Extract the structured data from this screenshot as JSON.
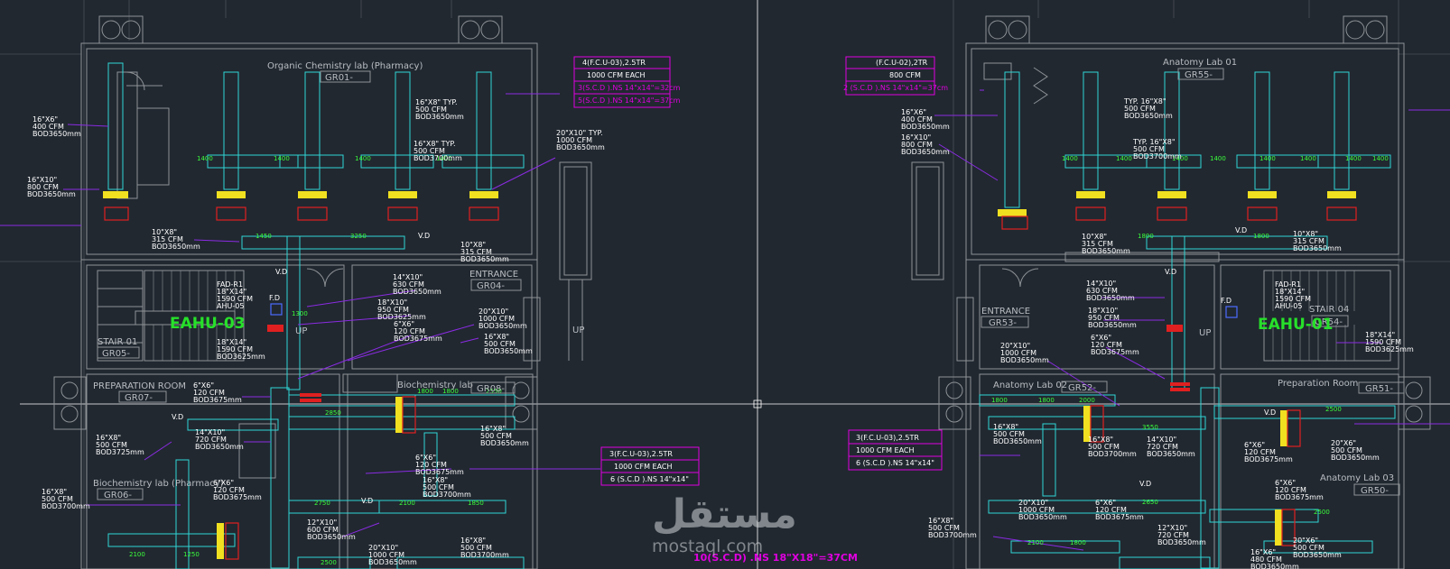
{
  "colors": {
    "background": "#212830",
    "wall": "#8d9296",
    "duct": "#2fd6d6",
    "leader": "#8a2be2",
    "magenta": "#e000e0",
    "green": "#27e12a",
    "yellow": "#f0e020",
    "red": "#e02020"
  },
  "rooms": {
    "organic": "Organic  Chemistry lab  (Pharmacy)",
    "gr01": "GR01-",
    "anatomy01": "Anatomy Lab 01",
    "gr55": "GR55-",
    "entrance_l": "ENTRANCE",
    "gr04": "GR04-",
    "entrance_r": "ENTRANCE",
    "gr53": "GR53-",
    "stair01": "STAIR 01",
    "gr05": "GR05-",
    "stair04": "STAIR 04",
    "gr54": "GR54-",
    "prep_l": "PREPARATION ROOM",
    "gr07": "GR07-",
    "biochem": "Biochemistry lab",
    "gr08": "GR08-",
    "anatomy02": "Anatomy Lab 02",
    "gr52": "GR52-",
    "prep_r": "Preparation Room",
    "gr51": "GR51-",
    "biochem_ph": "Biochemistry lab (Pharmacy)",
    "gr06": "GR06-",
    "anatomy03": "Anatomy Lab 03",
    "gr50": "GR50-",
    "up_l": "UP",
    "up_c": "UP",
    "up_r": "UP"
  },
  "equipment": {
    "eahu03": "EAHU-03",
    "eahu01": "EAHU-01",
    "fad_l": [
      "FAD-R1",
      "18\"X14\"",
      "1590 CFM",
      "AHU-05"
    ],
    "fad_r": [
      "FAD-R1",
      "18\"X14\"",
      "1590 CFM",
      "AHU-05"
    ],
    "fd_l": "F.D",
    "fd_r": "F.D"
  },
  "boxes": {
    "box1": [
      "4(F.C.U-03),2.5TR",
      "1000 CFM EACH",
      "3(S.C.D ).NS 14\"x14\"=32cm",
      "5(S.C.D ).NS 14\"x14\"=37cm"
    ],
    "box2": [
      "(F.C.U-02),2TR",
      "800 CFM",
      "2 (S.C.D ).NS 14\"x14\"=37cm"
    ],
    "box3": [
      "3(F.C.U-03),2.5TR",
      "1000 CFM EACH",
      "6  (S.C.D ).NS 14\"x14\""
    ],
    "box4": [
      "3(F.C.U-03),2.5TR",
      "1000 CFM EACH",
      "6  (S.C.D ).NS 14\"x14\""
    ]
  },
  "bottom_note": "10(S.C.D) .NS 18\"X18\"=37CM",
  "labels": [
    [
      "16\"X6\"",
      "400 CFM",
      "BOD3650mm"
    ],
    [
      "16\"X10\"",
      "800 CFM",
      "BOD3650mm"
    ],
    [
      "16\"X8\"  TYP.",
      "500 CFM",
      "BOD3650mm"
    ],
    [
      "16\"X8\" TYP.",
      "500 CFM",
      "BOD3700mm"
    ],
    [
      "20\"X10\" TYP.",
      "1000 CFM",
      "BOD3650mm"
    ],
    [
      "10\"X8\"",
      "315 CFM",
      "BOD3650mm"
    ],
    [
      "10\"X8\"",
      "315 CFM",
      "BOD3650mm"
    ],
    [
      "14\"X10\"",
      "630 CFM",
      "BOD3650mm"
    ],
    [
      "18\"X10\"",
      "950 CFM",
      "BOD3625mm"
    ],
    [
      "20\"X10\"",
      "1000 CFM",
      "BOD3650mm"
    ],
    [
      "6\"X6\"",
      "120 CFM",
      "BOD3675mm"
    ],
    [
      "16\"X8\"",
      "500 CFM",
      "BOD3650mm"
    ],
    [
      "18\"X14\"",
      "1590 CFM",
      "BOD3625mm"
    ],
    [
      "6\"X6\"",
      "120 CFM",
      "BOD3675mm"
    ],
    [
      "14\"X10\"",
      "720 CFM",
      "BOD3650mm"
    ],
    [
      "16\"X8\"",
      "500 CFM",
      "BOD3725mm"
    ],
    [
      "16\"X8\"",
      "500 CFM",
      "BOD3700mm"
    ],
    [
      "6\"X6\"",
      "120 CFM",
      "BOD3675mm"
    ],
    [
      "6\"X6\"",
      "120 CFM",
      "BOD3675mm"
    ],
    [
      "16\"X8\"",
      "500 CFM",
      "BOD3650mm"
    ],
    [
      "16\"X8\"",
      "500 CFM",
      "BOD3700mm"
    ],
    [
      "12\"X10\"",
      "600 CFM",
      "BOD3650mm"
    ],
    [
      "20\"X10\"",
      "1000 CFM",
      "BOD3650mm"
    ],
    [
      "16\"X8\"",
      "500 CFM",
      "BOD3700mm"
    ],
    [
      "16\"X6\"",
      "400 CFM",
      "BOD3650mm"
    ],
    [
      "16\"X10\"",
      "800 CFM",
      "BOD3650mm"
    ],
    [
      "TYP.  16\"X8\"",
      "500 CFM",
      "BOD3650mm"
    ],
    [
      "TYP.  16\"X8\"",
      "500 CFM",
      "BOD3700mm"
    ],
    [
      "10\"X8\"",
      "315 CFM",
      "BOD3650mm"
    ],
    [
      "10\"X8\"",
      "315 CFM",
      "BOD3650mm"
    ],
    [
      "14\"X10\"",
      "630 CFM",
      "BOD3650mm"
    ],
    [
      "18\"X10\"",
      "950 CFM",
      "BOD3650mm"
    ],
    [
      "6\"X6\"",
      "120 CFM",
      "BOD3675mm"
    ],
    [
      "18\"X14\"",
      "1590 CFM",
      "BOD3625mm"
    ],
    [
      "20\"X10\"",
      "1000 CFM",
      "BOD3650mm"
    ],
    [
      "16\"X8\"",
      "500 CFM",
      "BOD3650mm"
    ],
    [
      "16\"X8\"",
      "500 CFM",
      "BOD3700mm"
    ],
    [
      "14\"X10\"",
      "720 CFM",
      "BOD3650mm"
    ],
    [
      "6\"X6\"",
      "120 CFM",
      "BOD3675mm"
    ],
    [
      "20\"X6\"",
      "500 CFM",
      "BOD3650mm"
    ],
    [
      "6\"X6\"",
      "120 CFM",
      "BOD3675mm"
    ],
    [
      "20\"X10\"",
      "1000 CFM",
      "BOD3650mm"
    ],
    [
      "6\"X6\"",
      "120 CFM",
      "BOD3675mm"
    ],
    [
      "16\"X8\"",
      "500 CFM",
      "BOD3700mm"
    ],
    [
      "12\"X10\"",
      "720 CFM",
      "BOD3650mm"
    ],
    [
      "16\"X6\"",
      "480 CFM",
      "BOD3650mm"
    ],
    [
      "20\"X6\"",
      "500 CFM",
      "BOD3650mm"
    ]
  ],
  "vd": "V.D",
  "dims": [
    "1400",
    "1400",
    "1400",
    "1400",
    "1400",
    "1400",
    "1400",
    "1400",
    "1400",
    "1400",
    "1400",
    "1400",
    "1450",
    "3250",
    "1800",
    "1800",
    "1800",
    "1800",
    "2550",
    "1300",
    "2750",
    "2850",
    "2100",
    "1250",
    "2500",
    "1850",
    "2100",
    "1800",
    "1800",
    "2000",
    "2100",
    "1800",
    "3500",
    "2500",
    "1900",
    "3800",
    "1800",
    "1300",
    "3900",
    "3800",
    "3900",
    "3800",
    "3500",
    "3500",
    "3500",
    "3900",
    "3550",
    "2650"
  ],
  "watermark": {
    "arabic": "مستقل",
    "latin": "mostaql.com"
  }
}
